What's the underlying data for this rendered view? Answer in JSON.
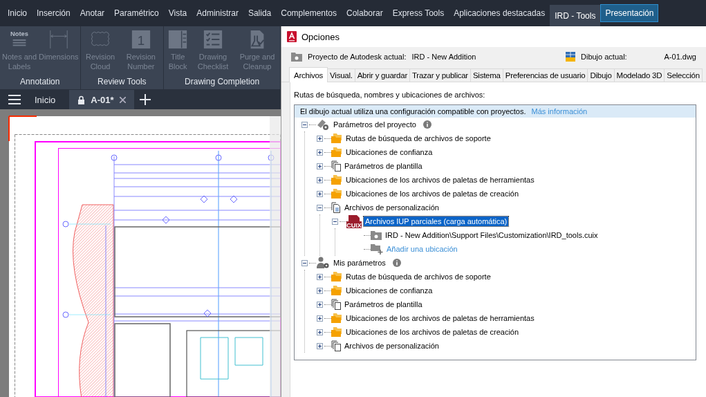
{
  "ribbon_tabs": [
    {
      "label": "Inicio",
      "selected": false,
      "outlined": false
    },
    {
      "label": "Inserción",
      "selected": false,
      "outlined": false
    },
    {
      "label": "Anotar",
      "selected": false,
      "outlined": false
    },
    {
      "label": "Paramétrico",
      "selected": false,
      "outlined": false
    },
    {
      "label": "Vista",
      "selected": false,
      "outlined": false
    },
    {
      "label": "Administrar",
      "selected": false,
      "outlined": false
    },
    {
      "label": "Salida",
      "selected": false,
      "outlined": false
    },
    {
      "label": "Complementos",
      "selected": false,
      "outlined": false
    },
    {
      "label": "Colaborar",
      "selected": false,
      "outlined": false
    },
    {
      "label": "Express Tools",
      "selected": false,
      "outlined": false
    },
    {
      "label": "Aplicaciones destacadas",
      "selected": false,
      "outlined": false
    },
    {
      "label": "IRD - Tools",
      "selected": true,
      "outlined": false
    },
    {
      "label": "Presentación",
      "selected": false,
      "outlined": true
    }
  ],
  "ribbon_panels": [
    {
      "title": "Annotation",
      "tools": [
        {
          "label": "Notes and Labels",
          "kind": "notes",
          "icon_text": "Notes",
          "disabled": true
        },
        {
          "label": "Dimensions",
          "kind": "dimension",
          "disabled": true
        }
      ]
    },
    {
      "title": "Review Tools",
      "tools": [
        {
          "label": "Revision Cloud",
          "kind": "cloud",
          "disabled": true
        },
        {
          "label": "Revision Number",
          "kind": "number",
          "icon_text": "1",
          "disabled": true
        }
      ]
    },
    {
      "title": "Drawing Completion",
      "tools": [
        {
          "label": "Title Block",
          "kind": "titleblock",
          "disabled": true
        },
        {
          "label": "Drawing Checklist",
          "kind": "checklist",
          "disabled": true
        },
        {
          "label": "Purge and Cleanup",
          "kind": "purge",
          "disabled": true
        }
      ]
    }
  ],
  "file_tabs": [
    {
      "label": "Inicio",
      "selected": false,
      "locked": false,
      "closable": false
    },
    {
      "label": "A-01*",
      "selected": true,
      "locked": true,
      "closable": true
    }
  ],
  "dialog": {
    "title": "Opciones",
    "project_label": "Proyecto de Autodesk actual:",
    "project_value": "IRD - New Addition",
    "drawing_label": "Dibujo actual:",
    "drawing_value": "A-01.dwg",
    "tabs": [
      {
        "label": "Archivos",
        "selected": true
      },
      {
        "label": "Visual.",
        "selected": false
      },
      {
        "label": "Abrir y guardar",
        "selected": false
      },
      {
        "label": "Trazar y publicar",
        "selected": false
      },
      {
        "label": "Sistema",
        "selected": false
      },
      {
        "label": "Preferencias de usuario",
        "selected": false
      },
      {
        "label": "Dibujo",
        "selected": false
      },
      {
        "label": "Modelado 3D",
        "selected": false
      },
      {
        "label": "Selección",
        "selected": false
      }
    ],
    "section_label": "Rutas de búsqueda, nombres y ubicaciones de archivos:",
    "banner": {
      "text": "El dibujo actual utiliza una configuración compatible con proyectos.",
      "link": "Más información"
    },
    "tree": [
      {
        "label": "Parámetros del proyecto",
        "kind": "project-settings",
        "info": true,
        "expanded": true,
        "selected": false,
        "children": [
          {
            "label": "Rutas de búsqueda de archivos de soporte",
            "kind": "folder",
            "expanded": false,
            "selected": false
          },
          {
            "label": "Ubicaciones de confianza",
            "kind": "folder",
            "expanded": false,
            "selected": false
          },
          {
            "label": "Parámetros de plantilla",
            "kind": "copies",
            "expanded": false,
            "selected": false
          },
          {
            "label": "Ubicaciones de los archivos de paletas de herramientas",
            "kind": "folder",
            "expanded": false,
            "selected": false
          },
          {
            "label": "Ubicaciones de los archivos de paletas de creación",
            "kind": "folder",
            "expanded": false,
            "selected": false
          },
          {
            "label": "Archivos de personalización",
            "kind": "document",
            "expanded": true,
            "selected": false,
            "children": [
              {
                "label": "Archivos IUP parciales (carga automática)",
                "kind": "cuix",
                "icon_text": "CUIX",
                "expanded": true,
                "selected": true,
                "children": [
                  {
                    "label": "IRD - New Addition\\Support Files\\Customization\\IRD_tools.cuix",
                    "kind": "location",
                    "selected": false
                  },
                  {
                    "label": "Añadir una ubicación",
                    "kind": "add-location",
                    "selected": false
                  }
                ]
              }
            ]
          }
        ]
      },
      {
        "label": "Mis parámetros",
        "kind": "user-settings",
        "info": true,
        "expanded": true,
        "selected": false,
        "children": [
          {
            "label": "Rutas de búsqueda de archivos de soporte",
            "kind": "folder",
            "expanded": false,
            "selected": false
          },
          {
            "label": "Ubicaciones de confianza",
            "kind": "folder",
            "expanded": false,
            "selected": false
          },
          {
            "label": "Parámetros de plantilla",
            "kind": "copies",
            "expanded": false,
            "selected": false
          },
          {
            "label": "Ubicaciones de los archivos de paletas de herramientas",
            "kind": "folder",
            "expanded": false,
            "selected": false
          },
          {
            "label": "Ubicaciones de los archivos de paletas de creación",
            "kind": "folder",
            "expanded": false,
            "selected": false
          },
          {
            "label": "Archivos de personalización",
            "kind": "copies",
            "expanded": false,
            "selected": false
          }
        ]
      }
    ]
  }
}
